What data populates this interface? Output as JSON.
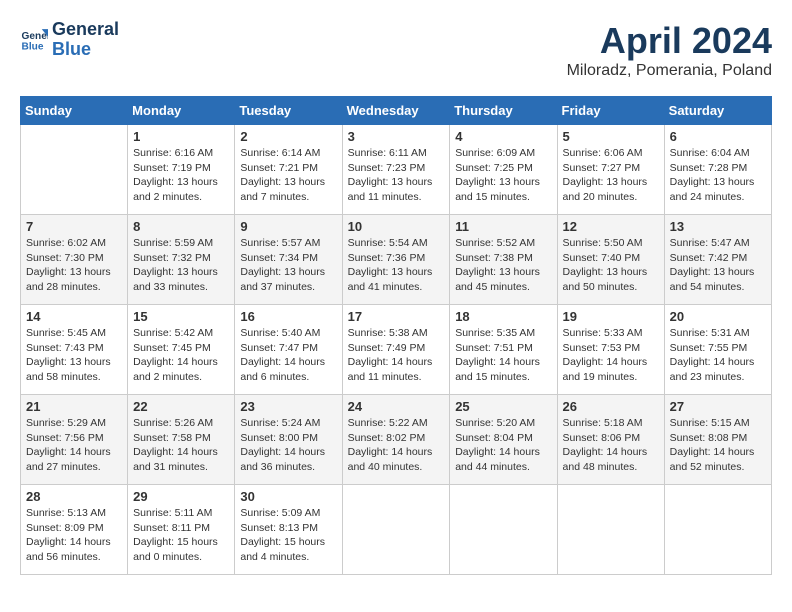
{
  "logo": {
    "line1": "General",
    "line2": "Blue"
  },
  "calendar": {
    "title": "April 2024",
    "subtitle": "Miloradz, Pomerania, Poland"
  },
  "weekdays": [
    "Sunday",
    "Monday",
    "Tuesday",
    "Wednesday",
    "Thursday",
    "Friday",
    "Saturday"
  ],
  "weeks": [
    [
      {
        "day": "",
        "info": ""
      },
      {
        "day": "1",
        "info": "Sunrise: 6:16 AM\nSunset: 7:19 PM\nDaylight: 13 hours\nand 2 minutes."
      },
      {
        "day": "2",
        "info": "Sunrise: 6:14 AM\nSunset: 7:21 PM\nDaylight: 13 hours\nand 7 minutes."
      },
      {
        "day": "3",
        "info": "Sunrise: 6:11 AM\nSunset: 7:23 PM\nDaylight: 13 hours\nand 11 minutes."
      },
      {
        "day": "4",
        "info": "Sunrise: 6:09 AM\nSunset: 7:25 PM\nDaylight: 13 hours\nand 15 minutes."
      },
      {
        "day": "5",
        "info": "Sunrise: 6:06 AM\nSunset: 7:27 PM\nDaylight: 13 hours\nand 20 minutes."
      },
      {
        "day": "6",
        "info": "Sunrise: 6:04 AM\nSunset: 7:28 PM\nDaylight: 13 hours\nand 24 minutes."
      }
    ],
    [
      {
        "day": "7",
        "info": "Sunrise: 6:02 AM\nSunset: 7:30 PM\nDaylight: 13 hours\nand 28 minutes."
      },
      {
        "day": "8",
        "info": "Sunrise: 5:59 AM\nSunset: 7:32 PM\nDaylight: 13 hours\nand 33 minutes."
      },
      {
        "day": "9",
        "info": "Sunrise: 5:57 AM\nSunset: 7:34 PM\nDaylight: 13 hours\nand 37 minutes."
      },
      {
        "day": "10",
        "info": "Sunrise: 5:54 AM\nSunset: 7:36 PM\nDaylight: 13 hours\nand 41 minutes."
      },
      {
        "day": "11",
        "info": "Sunrise: 5:52 AM\nSunset: 7:38 PM\nDaylight: 13 hours\nand 45 minutes."
      },
      {
        "day": "12",
        "info": "Sunrise: 5:50 AM\nSunset: 7:40 PM\nDaylight: 13 hours\nand 50 minutes."
      },
      {
        "day": "13",
        "info": "Sunrise: 5:47 AM\nSunset: 7:42 PM\nDaylight: 13 hours\nand 54 minutes."
      }
    ],
    [
      {
        "day": "14",
        "info": "Sunrise: 5:45 AM\nSunset: 7:43 PM\nDaylight: 13 hours\nand 58 minutes."
      },
      {
        "day": "15",
        "info": "Sunrise: 5:42 AM\nSunset: 7:45 PM\nDaylight: 14 hours\nand 2 minutes."
      },
      {
        "day": "16",
        "info": "Sunrise: 5:40 AM\nSunset: 7:47 PM\nDaylight: 14 hours\nand 6 minutes."
      },
      {
        "day": "17",
        "info": "Sunrise: 5:38 AM\nSunset: 7:49 PM\nDaylight: 14 hours\nand 11 minutes."
      },
      {
        "day": "18",
        "info": "Sunrise: 5:35 AM\nSunset: 7:51 PM\nDaylight: 14 hours\nand 15 minutes."
      },
      {
        "day": "19",
        "info": "Sunrise: 5:33 AM\nSunset: 7:53 PM\nDaylight: 14 hours\nand 19 minutes."
      },
      {
        "day": "20",
        "info": "Sunrise: 5:31 AM\nSunset: 7:55 PM\nDaylight: 14 hours\nand 23 minutes."
      }
    ],
    [
      {
        "day": "21",
        "info": "Sunrise: 5:29 AM\nSunset: 7:56 PM\nDaylight: 14 hours\nand 27 minutes."
      },
      {
        "day": "22",
        "info": "Sunrise: 5:26 AM\nSunset: 7:58 PM\nDaylight: 14 hours\nand 31 minutes."
      },
      {
        "day": "23",
        "info": "Sunrise: 5:24 AM\nSunset: 8:00 PM\nDaylight: 14 hours\nand 36 minutes."
      },
      {
        "day": "24",
        "info": "Sunrise: 5:22 AM\nSunset: 8:02 PM\nDaylight: 14 hours\nand 40 minutes."
      },
      {
        "day": "25",
        "info": "Sunrise: 5:20 AM\nSunset: 8:04 PM\nDaylight: 14 hours\nand 44 minutes."
      },
      {
        "day": "26",
        "info": "Sunrise: 5:18 AM\nSunset: 8:06 PM\nDaylight: 14 hours\nand 48 minutes."
      },
      {
        "day": "27",
        "info": "Sunrise: 5:15 AM\nSunset: 8:08 PM\nDaylight: 14 hours\nand 52 minutes."
      }
    ],
    [
      {
        "day": "28",
        "info": "Sunrise: 5:13 AM\nSunset: 8:09 PM\nDaylight: 14 hours\nand 56 minutes."
      },
      {
        "day": "29",
        "info": "Sunrise: 5:11 AM\nSunset: 8:11 PM\nDaylight: 15 hours\nand 0 minutes."
      },
      {
        "day": "30",
        "info": "Sunrise: 5:09 AM\nSunset: 8:13 PM\nDaylight: 15 hours\nand 4 minutes."
      },
      {
        "day": "",
        "info": ""
      },
      {
        "day": "",
        "info": ""
      },
      {
        "day": "",
        "info": ""
      },
      {
        "day": "",
        "info": ""
      }
    ]
  ]
}
